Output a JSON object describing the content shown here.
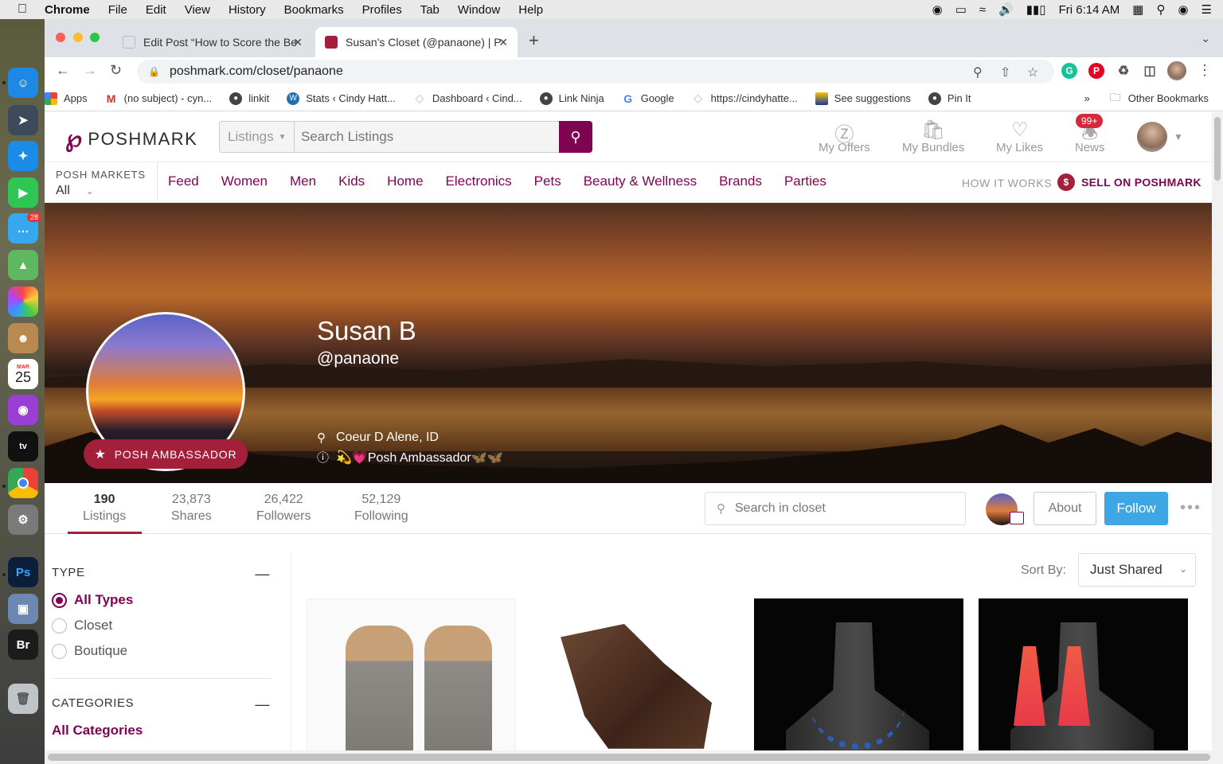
{
  "menubar": {
    "app": "Chrome",
    "items": [
      "File",
      "Edit",
      "View",
      "History",
      "Bookmarks",
      "Profiles",
      "Tab",
      "Window",
      "Help"
    ],
    "clock": "Fri 6:14 AM"
  },
  "dock": {
    "messages_badge": "28",
    "calendar_month": "MAR",
    "calendar_day": "25",
    "ps_label": "Ps",
    "br_label": "Br"
  },
  "tabs": [
    {
      "title": "Edit Post “How to Score the Be",
      "active": false
    },
    {
      "title": "Susan's Closet (@panaone) | P",
      "active": true
    }
  ],
  "address": {
    "url": "poshmark.com/closet/panaone"
  },
  "bookmarks": [
    {
      "label": "Apps",
      "icon": "apps-grid-icon",
      "color": "#e04a3a"
    },
    {
      "label": "(no subject) - cyn...",
      "icon": "gmail-icon",
      "color": "#d93025"
    },
    {
      "label": "linkit",
      "icon": "globe-icon",
      "color": "#444444"
    },
    {
      "label": "Stats ‹ Cindy Hatt...",
      "icon": "wordpress-icon",
      "color": "#2271b1"
    },
    {
      "label": "Dashboard ‹ Cind...",
      "icon": "diamond-icon",
      "color": "#bbbbbb"
    },
    {
      "label": "Link Ninja",
      "icon": "globe-icon",
      "color": "#444444"
    },
    {
      "label": "Google",
      "icon": "google-icon",
      "color": "#4285f4"
    },
    {
      "label": "https://cindyhatte...",
      "icon": "diamond-icon",
      "color": "#bbbbbb"
    },
    {
      "label": "See suggestions",
      "icon": "tv-icon",
      "color": "#1a3a8a"
    },
    {
      "label": "Pin It",
      "icon": "globe-icon",
      "color": "#444444"
    }
  ],
  "bookmarks_overflow": "»",
  "other_bookmarks": "Other Bookmarks",
  "poshmark": {
    "logo_text": "POSHMARK",
    "search_category": "Listings",
    "search_placeholder": "Search Listings",
    "header_items": [
      "My Offers",
      "My Bundles",
      "My Likes",
      "News"
    ],
    "news_badge": "99+",
    "markets_label": "POSH MARKETS",
    "markets_value": "All",
    "categories": [
      "Feed",
      "Women",
      "Men",
      "Kids",
      "Home",
      "Electronics",
      "Pets",
      "Beauty & Wellness",
      "Brands",
      "Parties"
    ],
    "how_it_works": "HOW IT WORKS",
    "sell_label": "SELL ON POSHMARK",
    "accent": "#7f0353"
  },
  "profile": {
    "name": "Susan B",
    "handle": "@panaone",
    "ambassador_badge": "POSH AMBASSADOR",
    "location": "Coeur D Alene, ID",
    "bio": "💫💗Posh Ambassador🦋🦋"
  },
  "stats": [
    {
      "value": "190",
      "label": "Listings"
    },
    {
      "value": "23,873",
      "label": "Shares"
    },
    {
      "value": "26,422",
      "label": "Followers"
    },
    {
      "value": "52,129",
      "label": "Following"
    }
  ],
  "closet_search_placeholder": "Search in closet",
  "about_label": "About",
  "follow_label": "Follow",
  "follow_color": "#3ea6e4",
  "filters": {
    "type_heading": "TYPE",
    "types": [
      "All Types",
      "Closet",
      "Boutique"
    ],
    "selected_type": "All Types",
    "categories_heading": "CATEGORIES",
    "all_categories": "All Categories"
  },
  "sort": {
    "label": "Sort By:",
    "value": "Just Shared"
  },
  "listings": [
    {
      "subject": "grey-suede-mules"
    },
    {
      "subject": "brown-lace-up-boots"
    },
    {
      "subject": "blue-bead-necklace-earrings"
    },
    {
      "subject": "red-tassel-hoop-earrings"
    }
  ]
}
